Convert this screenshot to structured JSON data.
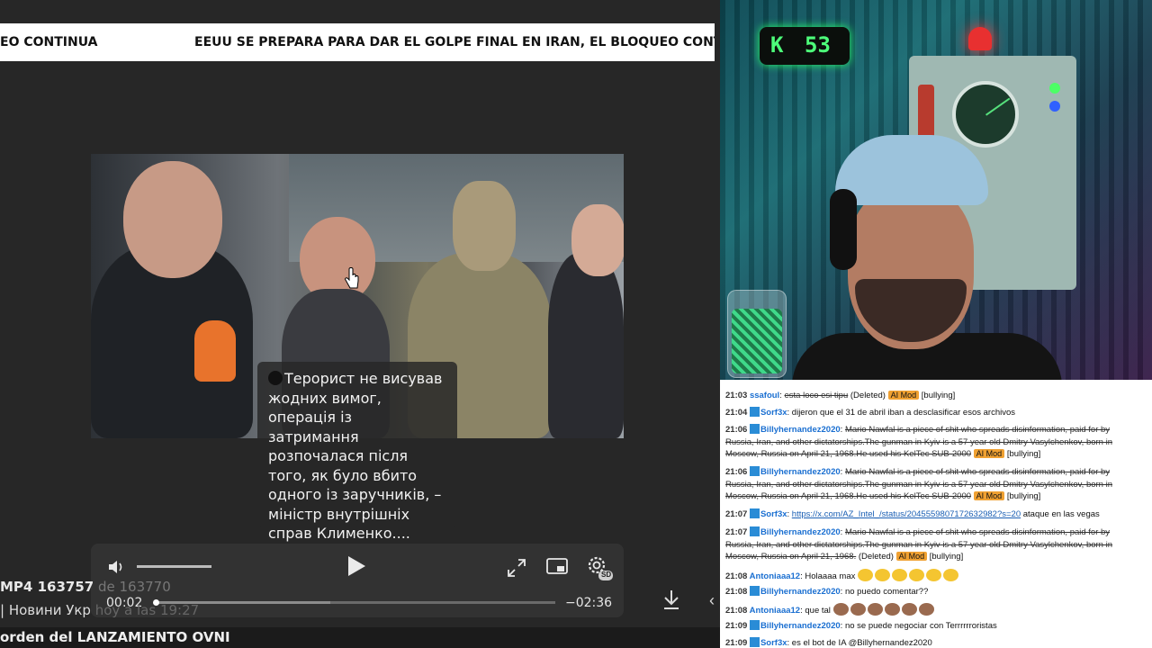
{
  "ticker": {
    "left_text": "EO CONTINUA",
    "right_text": "EEUU SE PREPARA PARA DAR EL GOLPE FINAL EN IRAN, EL BLOQUEO CONTINUA"
  },
  "player": {
    "subtitle": "Терорист не висував жодних вимог, операція із затримання розпочалася після того, як було вбито одного із заручників, – міністр внутрішніх справ Клименко....",
    "current_time": "00:02",
    "remaining_time": "−02:36",
    "progress": 0.002,
    "buffered": 0.44,
    "volume": 1.0,
    "settings_badge": "SD"
  },
  "post": {
    "filename": "MP4 163757",
    "filename_dim": " de 163770",
    "channel": "Новини Укр",
    "channel_dim": "hoy a las 19:27",
    "separator": "|"
  },
  "bottom_bar": {
    "title": "orden del LANZAMIENTO OVNI"
  },
  "counter": {
    "icon": "K",
    "value": "53"
  },
  "colors": {
    "chat_user_blue": "#1a6fd1",
    "ai_mod_badge": "#f0a132",
    "counter_green": "#4dff7a"
  },
  "chat": [
    {
      "time": "21:03",
      "user": "ssafoul",
      "text": "esta loco esi tipu",
      "deleted": true,
      "tail": "(Deleted)",
      "badge": "AI Mod",
      "reason": "[bullying]",
      "color": "#1a6fd1",
      "icon": false
    },
    {
      "time": "21:04",
      "user": "Sorf3x",
      "text": "dijeron que el 31 de abril iban a desclasificar esos archivos",
      "deleted": false,
      "color": "#1a6fd1",
      "icon": true
    },
    {
      "time": "21:06",
      "user": "Billyhernandez2020",
      "text": "Mario Nawfal is a piece of shit who spreads disinformation, paid for by Russia, Iran, and other dictatorships.The gunman in Kyiv is a 57 year old Dmitry Vasylchenkov, born in Moscow, Russia on April 21, 1968.He used his KelTec SUB-2000",
      "deleted": true,
      "badge": "AI Mod",
      "reason": "[bullying]",
      "color": "#1a6fd1",
      "icon": true
    },
    {
      "time": "21:06",
      "user": "Billyhernandez2020",
      "text": "Mario Nawfal is a piece of shit who spreads disinformation, paid for by Russia, Iran, and other dictatorships.The gunman in Kyiv is a 57 year old Dmitry Vasylchenkov, born in Moscow, Russia on April 21, 1968.He used his KelTec SUB-2000",
      "deleted": true,
      "badge": "AI Mod",
      "reason": "[bullying]",
      "color": "#1a6fd1",
      "icon": true
    },
    {
      "time": "21:07",
      "user": "Sorf3x",
      "link": "https://x.com/AZ_Intel_/status/2045559807172632982?s=20",
      "text": " ataque en las vegas",
      "deleted": false,
      "color": "#1a6fd1",
      "icon": true
    },
    {
      "time": "21:07",
      "user": "Billyhernandez2020",
      "text": "Mario Nawfal is a piece of shit who spreads disinformation, paid for by Russia, Iran, and other dictatorships.The gunman in Kyiv is a 57 year old Dmitry Vasylchenkov, born in Moscow, Russia on April 21, 1968.",
      "deleted": true,
      "tail": "(Deleted)",
      "badge": "AI Mod",
      "reason": "[bullying]",
      "color": "#1a6fd1",
      "icon": true
    },
    {
      "time": "21:08",
      "user": "Antoniaaa12",
      "text": "Holaaaa max",
      "deleted": false,
      "emotes": "pika",
      "emote_count": 6,
      "color": "#1a6fd1",
      "icon": false
    },
    {
      "time": "21:08",
      "user": "Billyhernandez2020",
      "text": "no puedo comentar??",
      "deleted": false,
      "color": "#1a6fd1",
      "icon": true
    },
    {
      "time": "21:08",
      "user": "Antoniaaa12",
      "text": "que tal",
      "deleted": false,
      "emotes": "brown",
      "emote_count": 6,
      "color": "#1a6fd1",
      "icon": false
    },
    {
      "time": "21:09",
      "user": "Billyhernandez2020",
      "text": "no se puede negociar con Terrrrrroristas",
      "deleted": false,
      "color": "#1a6fd1",
      "icon": true
    },
    {
      "time": "21:09",
      "user": "Sorf3x",
      "text": "es el bot de IA @Billyhernandez2020",
      "deleted": false,
      "color": "#1a6fd1",
      "icon": true
    }
  ]
}
